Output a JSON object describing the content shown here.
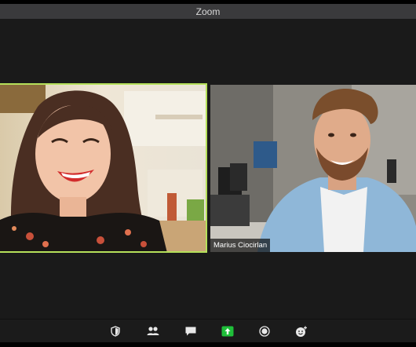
{
  "window": {
    "title": "Zoom"
  },
  "participants": [
    {
      "name": "",
      "active_speaker": true
    },
    {
      "name": "Marius Ciocirlan",
      "active_speaker": false
    }
  ],
  "toolbar": {
    "buttons": [
      {
        "icon": "security-shield-icon"
      },
      {
        "icon": "participants-icon"
      },
      {
        "icon": "chat-icon"
      },
      {
        "icon": "share-screen-icon",
        "color": "#1fbf3a"
      },
      {
        "icon": "record-icon"
      },
      {
        "icon": "reactions-icon"
      }
    ]
  },
  "colors": {
    "active_speaker_border": "#b5e05a",
    "share_screen_green": "#1fbf3a",
    "titlebar": "#3a3a3c",
    "stage": "#1a1a1a"
  }
}
